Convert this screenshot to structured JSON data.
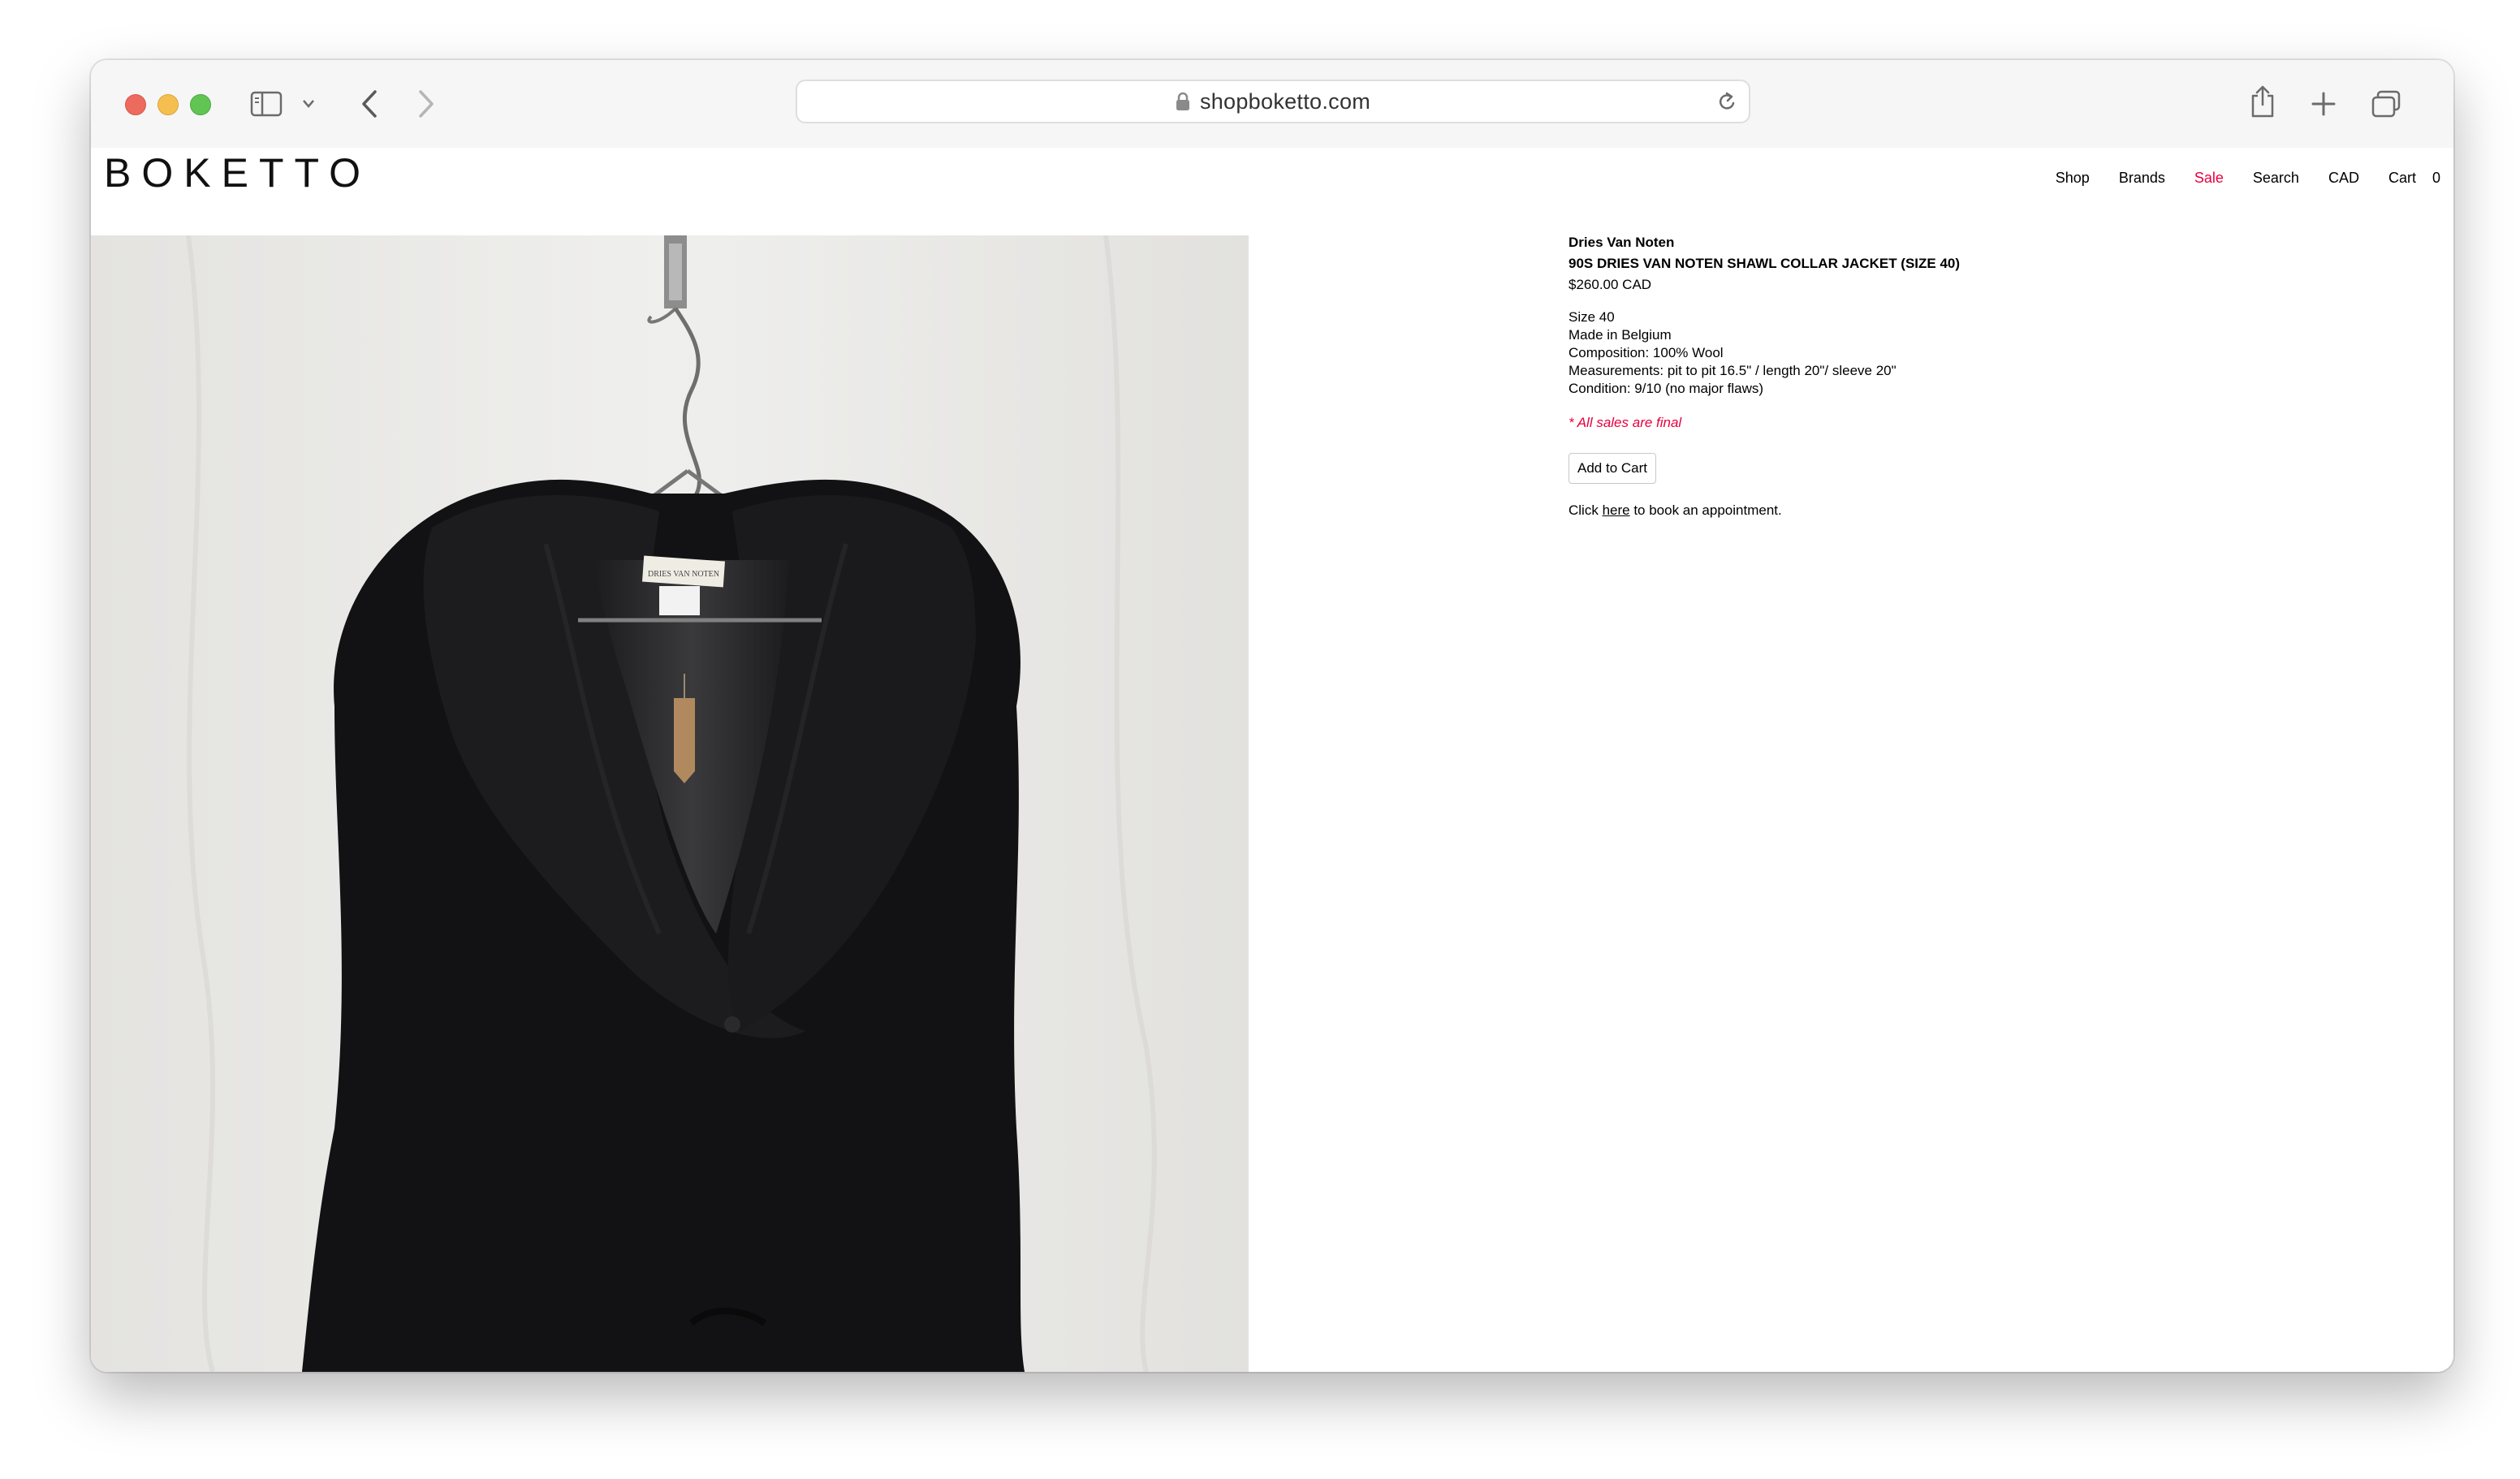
{
  "browser": {
    "url": "shopboketto.com",
    "icons": {
      "sidebar": "sidebar-icon",
      "chevron": "chevron-down-icon",
      "back": "back-arrow-icon",
      "forward": "forward-arrow-icon",
      "lock": "lock-icon",
      "reload": "reload-icon",
      "share": "share-icon",
      "new_tab": "plus-icon",
      "tabs": "tab-overview-icon"
    }
  },
  "site": {
    "logo": "BOKETTO",
    "nav": {
      "shop": "Shop",
      "brands": "Brands",
      "sale": "Sale",
      "search": "Search",
      "currency": "CAD",
      "cart": "Cart",
      "cart_count": "0"
    },
    "colors": {
      "sale": "#e8003d",
      "text": "#000000"
    }
  },
  "product": {
    "brand": "Dries Van Noten",
    "title": "90S DRIES VAN NOTEN SHAWL COLLAR JACKET (SIZE 40)",
    "price": "$260.00 CAD",
    "details": {
      "size": "Size 40",
      "origin": "Made in Belgium",
      "composition": "Composition: 100% Wool",
      "measurements": "Measurements: pit to pit 16.5\" / length 20\"/ sleeve 20\"",
      "condition": "Condition: 9/10 (no major flaws)"
    },
    "final_sale": "* All sales are final",
    "add_to_cart": "Add to Cart",
    "appointment": {
      "prefix": "Click ",
      "link": "here",
      "suffix": " to book an appointment."
    },
    "image_label": "DRIES VAN NOTEN"
  }
}
